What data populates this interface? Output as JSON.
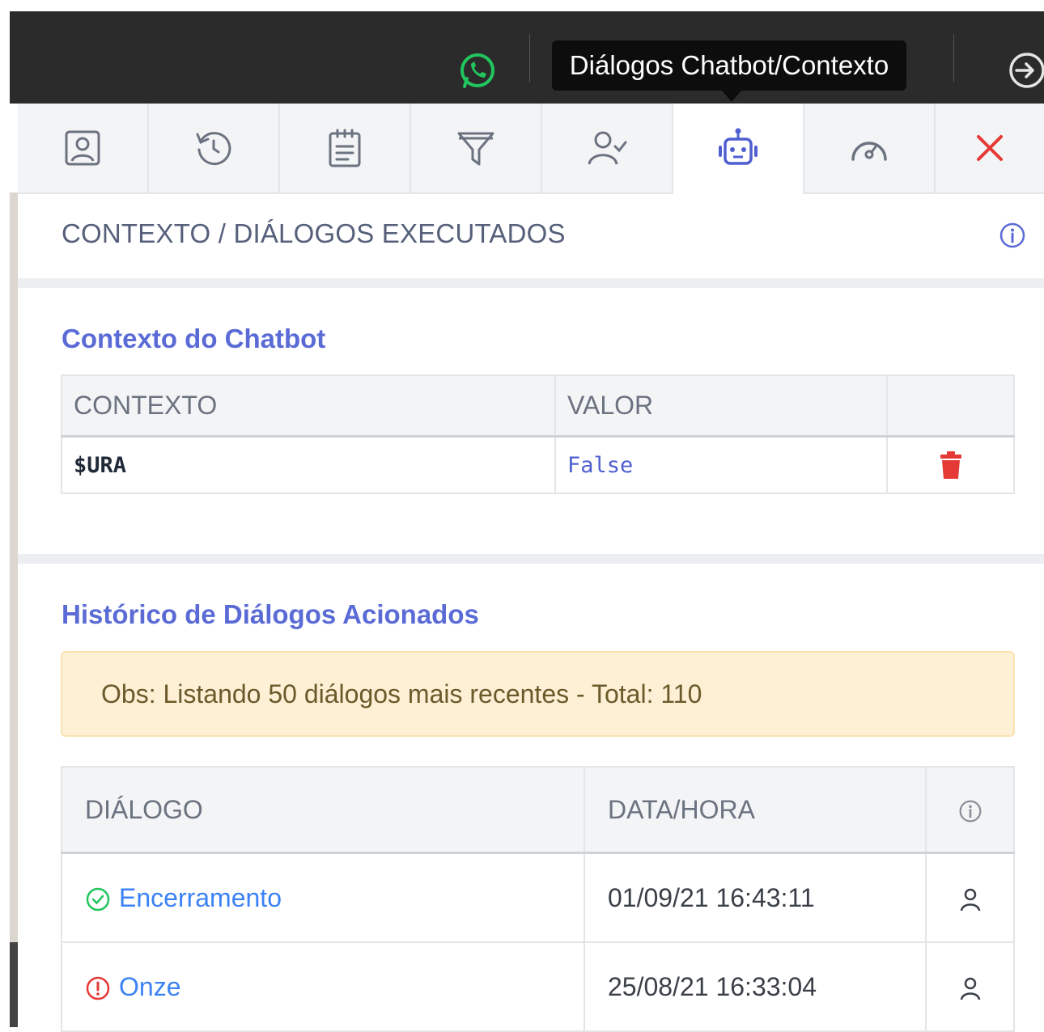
{
  "topbar": {
    "tooltip": "Diálogos Chatbot/Contexto",
    "icons": [
      "whatsapp-icon",
      "exit-icon"
    ]
  },
  "tabs": [
    {
      "icon": "contact-card-icon",
      "active": false
    },
    {
      "icon": "history-icon",
      "active": false
    },
    {
      "icon": "clipboard-icon",
      "active": false
    },
    {
      "icon": "filter-icon",
      "active": false
    },
    {
      "icon": "user-check-icon",
      "active": false
    },
    {
      "icon": "robot-icon",
      "active": true
    },
    {
      "icon": "speedometer-icon",
      "active": false
    },
    {
      "icon": "close-icon",
      "active": false
    }
  ],
  "colors": {
    "accent": "#5b6bd6",
    "link": "#3b82f6",
    "danger": "#e53935",
    "success": "#22c55e",
    "alert_bg": "#fdf0d5"
  },
  "section": {
    "title": "CONTEXTO / DIÁLOGOS EXECUTADOS"
  },
  "context": {
    "title": "Contexto do Chatbot",
    "columns": [
      "CONTEXTO",
      "VALOR",
      ""
    ],
    "rows": [
      {
        "key": "$URA",
        "value": "False"
      }
    ]
  },
  "history": {
    "title": "Histórico de Diálogos Acionados",
    "notice": "Obs: Listando 50 diálogos mais recentes - Total: 110",
    "columns": [
      "DIÁLOGO",
      "DATA/HORA"
    ],
    "rows": [
      {
        "status": "success",
        "dialog": "Encerramento",
        "datetime": "01/09/21 16:43:11"
      },
      {
        "status": "error",
        "dialog": "Onze",
        "datetime": "25/08/21 16:33:04"
      }
    ]
  }
}
